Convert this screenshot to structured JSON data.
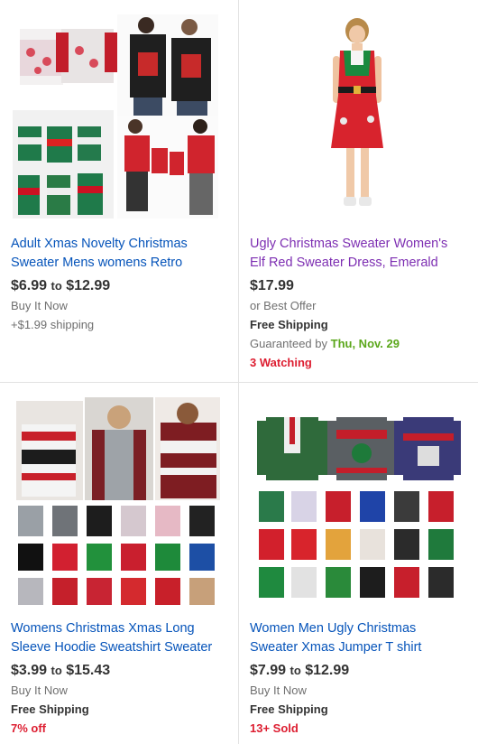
{
  "listings": [
    {
      "title": "Adult Xmas Novelty Christmas Sweater Mens womens Retro",
      "price_low": "$6.99",
      "price_sep": "to",
      "price_high": "$12.99",
      "format": "Buy It Now",
      "shipping": "+$1.99 shipping",
      "image_icon": "ugly-sweater-collage-image"
    },
    {
      "title": "Ugly Christmas Sweater  Women's Elf Red Sweater Dress, Emerald",
      "price": "$17.99",
      "format": "or Best Offer",
      "shipping": "Free Shipping",
      "guaranteed_label": "Guaranteed by",
      "guaranteed_date": "Thu, Nov. 29",
      "watching": "3 Watching",
      "image_icon": "elf-dress-image"
    },
    {
      "title": "Womens Christmas Xmas Long Sleeve Hoodie Sweatshirt Sweater",
      "price_low": "$3.99",
      "price_sep": "to",
      "price_high": "$15.43",
      "format": "Buy It Now",
      "shipping": "Free Shipping",
      "discount": "7% off",
      "image_icon": "hoodie-collage-image"
    },
    {
      "title": "Women Men Ugly Christmas Sweater Xmas Jumper T shirt",
      "price_low": "$7.99",
      "price_sep": "to",
      "price_high": "$12.99",
      "format": "Buy It Now",
      "shipping": "Free Shipping",
      "sold": "13+ Sold",
      "image_icon": "jumper-grid-image"
    }
  ],
  "colors": {
    "link": "#0654ba",
    "visited_link": "#7d2eb2",
    "red": "#dd1e31",
    "green": "#5ba71b",
    "text": "#333333",
    "muted": "#707070"
  }
}
